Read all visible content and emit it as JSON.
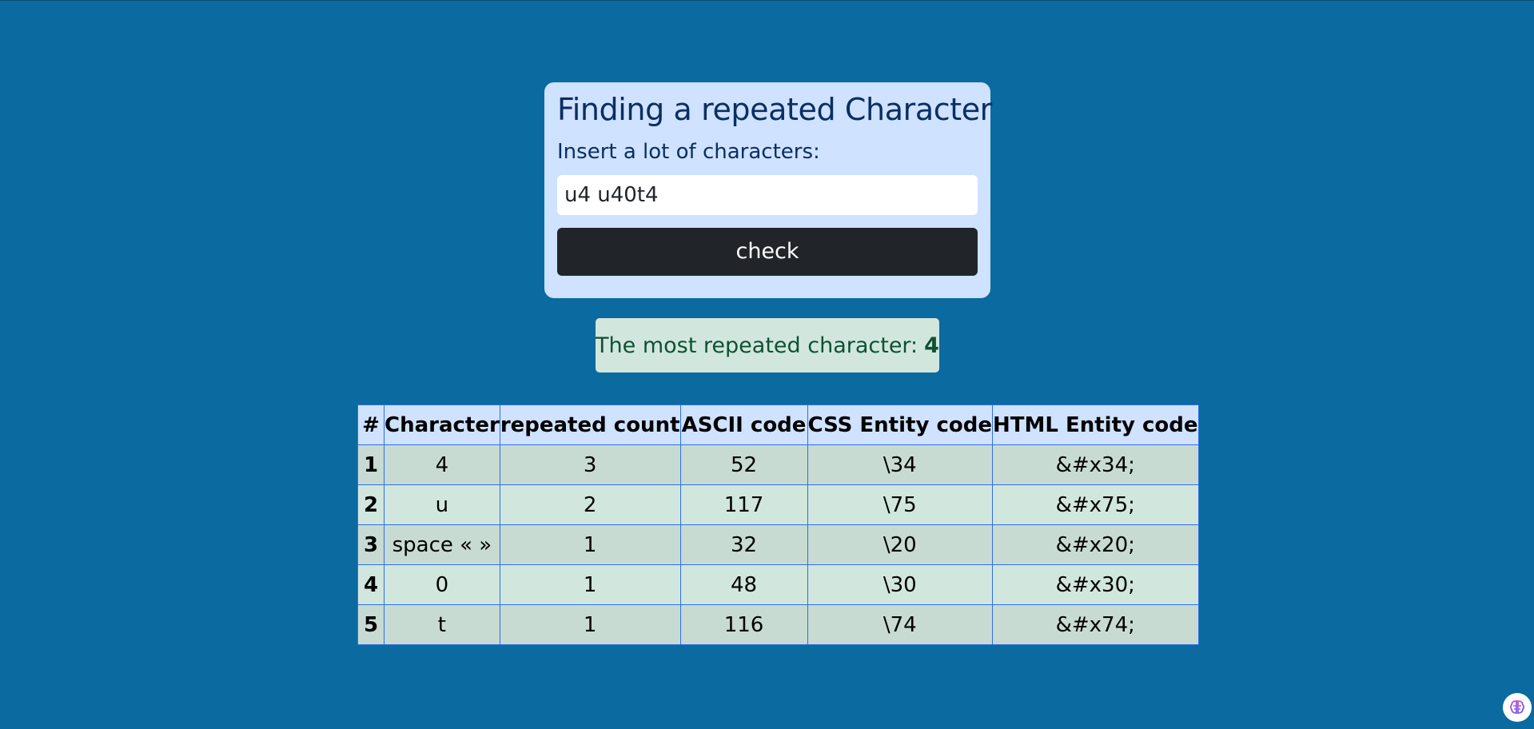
{
  "card": {
    "title": "Finding a repeated Character",
    "label": "Insert a lot of characters:",
    "input_value": "u4 u40t4",
    "button_label": "check"
  },
  "result": {
    "prefix": "The most repeated character:",
    "value": "4"
  },
  "table": {
    "headers": [
      "#",
      "Character",
      "repeated count",
      "ASCII code",
      "CSS Entity code",
      "HTML Entity code"
    ],
    "rows": [
      [
        "1",
        "4",
        "3",
        "52",
        "\\34",
        "&#x34;"
      ],
      [
        "2",
        "u",
        "2",
        "117",
        "\\75",
        "&#x75;"
      ],
      [
        "3",
        "space « »",
        "1",
        "32",
        "\\20",
        "&#x20;"
      ],
      [
        "4",
        "0",
        "1",
        "48",
        "\\30",
        "&#x30;"
      ],
      [
        "5",
        "t",
        "1",
        "116",
        "\\74",
        "&#x74;"
      ]
    ]
  },
  "colors": {
    "background": "#0b6a9f",
    "card": "#cfe2ff",
    "button": "#212529",
    "result": "#d1e7dd"
  },
  "icons": {
    "corner": "brain-icon"
  }
}
